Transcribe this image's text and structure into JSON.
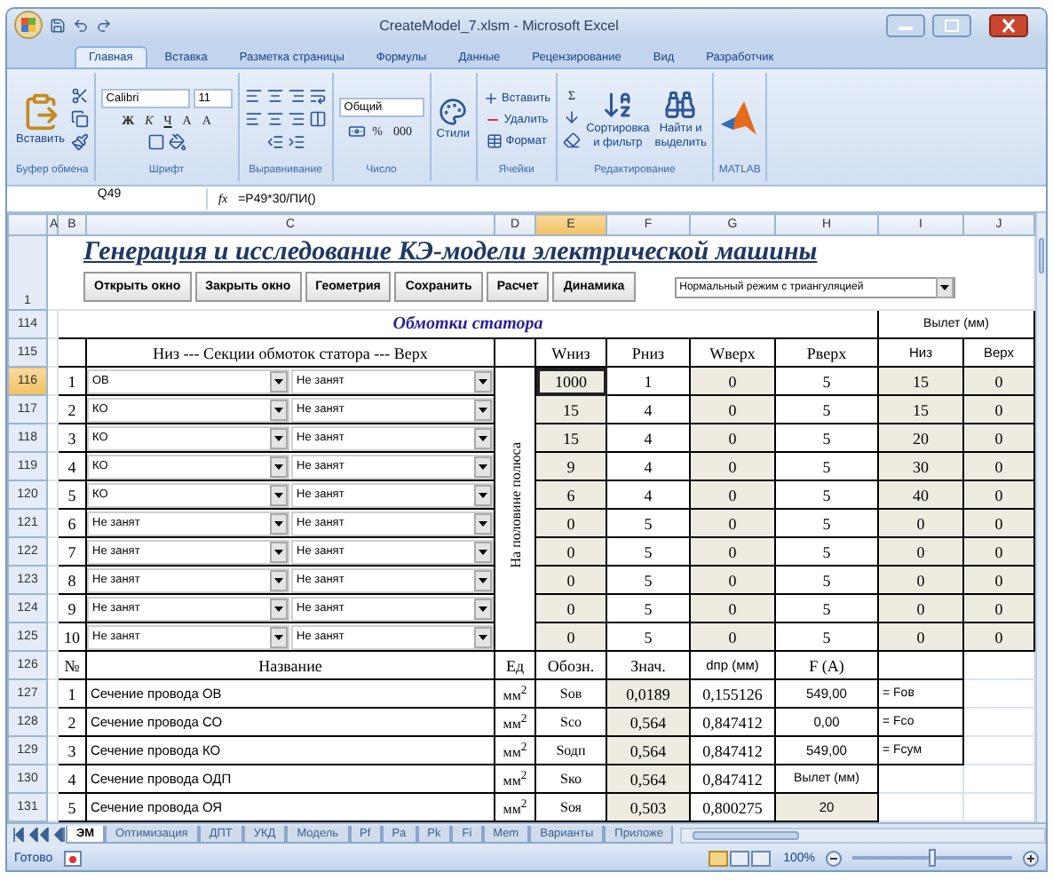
{
  "window": {
    "title": "CreateModel_7.xlsm - Microsoft Excel"
  },
  "ribbon_tabs": [
    {
      "label": "Главная",
      "selected": true
    },
    {
      "label": "Вставка",
      "selected": false
    },
    {
      "label": "Разметка страницы",
      "selected": false
    },
    {
      "label": "Формулы",
      "selected": false
    },
    {
      "label": "Данные",
      "selected": false
    },
    {
      "label": "Рецензирование",
      "selected": false
    },
    {
      "label": "Вид",
      "selected": false
    },
    {
      "label": "Разработчик",
      "selected": false
    }
  ],
  "ribbon_groups": [
    {
      "kind": "clipboard",
      "label": "Буфер обмена",
      "texts": [
        "Вставить"
      ]
    },
    {
      "kind": "font",
      "label": "Шрифт",
      "texts": [
        "Calibri",
        "11",
        "Ж",
        "К",
        "Ч",
        "A",
        "A"
      ]
    },
    {
      "kind": "alignment",
      "label": "Выравнивание"
    },
    {
      "kind": "number",
      "label": "Число",
      "texts": [
        "Общий",
        "%",
        "000"
      ]
    },
    {
      "kind": "styles",
      "texts": [
        "Стили"
      ]
    },
    {
      "kind": "cells",
      "label": "Ячейки",
      "texts": [
        "Вставить",
        "Удалить",
        "Формат"
      ]
    },
    {
      "kind": "editing",
      "label": "Редактирование",
      "texts": [
        "Σ",
        "Сортировка",
        "и фильтр",
        "Найти и",
        "выделить"
      ]
    },
    {
      "kind": "matlab",
      "label": "MATLAB"
    }
  ],
  "formula_bar": {
    "name_box": "Q49",
    "fx": "fx",
    "formula": "=P49*30/ПИ()"
  },
  "columns": [
    {
      "label": "A",
      "selected": false
    },
    {
      "label": "B",
      "selected": false
    },
    {
      "label": "C",
      "selected": false
    },
    {
      "label": "D",
      "selected": false
    },
    {
      "label": "E",
      "selected": true
    },
    {
      "label": "F",
      "selected": false
    },
    {
      "label": "G",
      "selected": false
    },
    {
      "label": "H",
      "selected": false
    },
    {
      "label": "I",
      "selected": false
    },
    {
      "label": "J",
      "selected": false
    }
  ],
  "header_row": {
    "row": "1",
    "title": "Генерация и исследование КЭ-модели электрической машины",
    "buttons": [
      "Открыть окно",
      "Закрыть окно",
      "Геометрия",
      "Сохранить",
      "Расчет",
      "Динамика"
    ],
    "mode": "Нормальный режим с триангуляцией"
  },
  "windings_title_row": {
    "row": "114",
    "title": "Обмотки статора",
    "overhang": "Вылет (мм)"
  },
  "windings_header_row": {
    "row": "115",
    "section_label": "Низ --- Секции обмоток статора --- Верх",
    "columns": [
      "Wниз",
      "Рниз",
      "Wверх",
      "Рверх",
      "Низ",
      "Верх"
    ]
  },
  "side_label": "На половине полюса",
  "sections": [
    {
      "row": "116",
      "selected": true,
      "n": "1",
      "lower": "ОВ",
      "upper": "Не занят",
      "cells": [
        "1000",
        "1",
        "0",
        "5",
        "15",
        "0"
      ]
    },
    {
      "row": "117",
      "selected": false,
      "n": "2",
      "lower": "КО",
      "upper": "Не занят",
      "cells": [
        "15",
        "4",
        "0",
        "5",
        "15",
        "0"
      ]
    },
    {
      "row": "118",
      "selected": false,
      "n": "3",
      "lower": "КО",
      "upper": "Не занят",
      "cells": [
        "15",
        "4",
        "0",
        "5",
        "20",
        "0"
      ]
    },
    {
      "row": "119",
      "selected": false,
      "n": "4",
      "lower": "КО",
      "upper": "Не занят",
      "cells": [
        "9",
        "4",
        "0",
        "5",
        "30",
        "0"
      ]
    },
    {
      "row": "120",
      "selected": false,
      "n": "5",
      "lower": "КО",
      "upper": "Не занят",
      "cells": [
        "6",
        "4",
        "0",
        "5",
        "40",
        "0"
      ]
    },
    {
      "row": "121",
      "selected": false,
      "n": "6",
      "lower": "Не занят",
      "upper": "Не занят",
      "cells": [
        "0",
        "5",
        "0",
        "5",
        "0",
        "0"
      ]
    },
    {
      "row": "122",
      "selected": false,
      "n": "7",
      "lower": "Не занят",
      "upper": "Не занят",
      "cells": [
        "0",
        "5",
        "0",
        "5",
        "0",
        "0"
      ]
    },
    {
      "row": "123",
      "selected": false,
      "n": "8",
      "lower": "Не занят",
      "upper": "Не занят",
      "cells": [
        "0",
        "5",
        "0",
        "5",
        "0",
        "0"
      ]
    },
    {
      "row": "124",
      "selected": false,
      "n": "9",
      "lower": "Не занят",
      "upper": "Не занят",
      "cells": [
        "0",
        "5",
        "0",
        "5",
        "0",
        "0"
      ]
    },
    {
      "row": "125",
      "selected": false,
      "n": "10",
      "lower": "Не занят",
      "upper": "Не занят",
      "cells": [
        "0",
        "5",
        "0",
        "5",
        "0",
        "0"
      ]
    }
  ],
  "params_header_row": {
    "row": "126",
    "labels": [
      "№",
      "Название",
      "Ед",
      "Обозн.",
      "Знач.",
      "dпр (мм)",
      "F (A)"
    ]
  },
  "params": [
    {
      "row": "127",
      "n": "1",
      "name": "Сечение провода ОВ",
      "unit": "мм$^{2}$",
      "symbol": "Sов",
      "value": "0,0189",
      "dpr": "0,155126",
      "f": "549,00",
      "kind": "result",
      "note": "= Fов"
    },
    {
      "row": "128",
      "n": "2",
      "name": "Сечение провода СО",
      "unit": "мм$^{2}$",
      "symbol": "Sсо",
      "value": "0,564",
      "dpr": "0,847412",
      "f": "0,00",
      "kind": "result",
      "note": "= Fсо"
    },
    {
      "row": "129",
      "n": "3",
      "name": "Сечение провода КО",
      "unit": "мм$^{2}$",
      "symbol": "Sодп",
      "value": "0,564",
      "dpr": "0,847412",
      "f": "549,00",
      "kind": "result",
      "note": "= Fсум"
    },
    {
      "row": "130",
      "n": "4",
      "name": "Сечение провода ОДП",
      "unit": "мм$^{2}$",
      "symbol": "Sко",
      "value": "0,564",
      "dpr": "0,847412",
      "f": "Вылет (мм)",
      "kind": "label"
    },
    {
      "row": "131",
      "n": "5",
      "name": "Сечение провода ОЯ",
      "unit": "мм$^{2}$",
      "symbol": "Sоя",
      "value": "0,503",
      "dpr": "0,800275",
      "f": "20",
      "kind": "input"
    }
  ],
  "sheet_tabs": [
    {
      "label": "ЭМ",
      "selected": true
    },
    {
      "label": "Оптимизация",
      "selected": false
    },
    {
      "label": "ДПТ",
      "selected": false
    },
    {
      "label": "УКД",
      "selected": false
    },
    {
      "label": "Модель",
      "selected": false
    },
    {
      "label": "Pf",
      "selected": false
    },
    {
      "label": "Pa",
      "selected": false
    },
    {
      "label": "Pk",
      "selected": false
    },
    {
      "label": "Fi",
      "selected": false
    },
    {
      "label": "Mem",
      "selected": false
    },
    {
      "label": "Варианты",
      "selected": false
    },
    {
      "label": "Приложе",
      "selected": false
    }
  ],
  "status_bar": {
    "text": "Готово",
    "zoom": "100%",
    "level": 0.5
  }
}
